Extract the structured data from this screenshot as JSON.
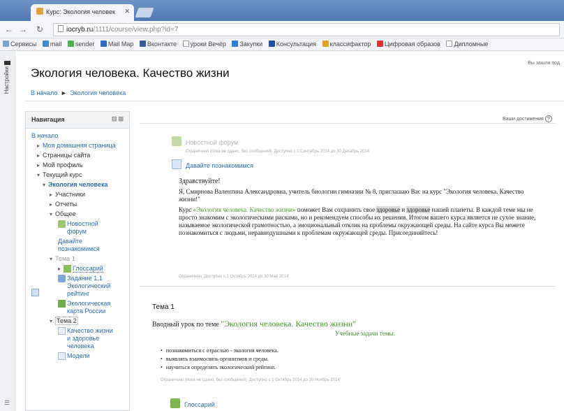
{
  "browser": {
    "tab_title": "Курс: Экология человек",
    "url_host": "iocryb.ru",
    "url_path": "/1111/course/view.php?id=7",
    "bookmarks": [
      "Сервисы",
      "mail",
      "sender",
      "Mail Map",
      "Вконтакте",
      "уроки Вечёр",
      "Закупки",
      "Консультация",
      "классифактор",
      "Цифровая образов",
      "Дипломные"
    ]
  },
  "page": {
    "strip_label": "Настройки",
    "title": "Экология человека. Качество жизни",
    "top_right": "Вы зашли под",
    "breadcrumb": [
      "В начало",
      "Экология человека"
    ],
    "breadcrumb_sep": "►",
    "edit_mode": "Ваши достижения"
  },
  "navigation": {
    "heading": "Навигация",
    "items": [
      {
        "label": "В начало"
      },
      {
        "label": "Моя домашняя страница"
      },
      {
        "label": "Страницы сайта"
      },
      {
        "label": "Мой профиль"
      },
      {
        "label": "Текущий курс"
      },
      {
        "label": "Экология человека"
      },
      {
        "label": "Участники"
      },
      {
        "label": "Отчеты"
      },
      {
        "label": "Общее"
      },
      {
        "label": "Новостной форум"
      },
      {
        "label": "Давайте познакомимся"
      },
      {
        "label": "Тема 1"
      },
      {
        "label": "Глоссарий"
      },
      {
        "label": "Задание 1.1 Экологический рейтинг"
      },
      {
        "label": "Экологическая карта России"
      },
      {
        "label": "Тема 2"
      },
      {
        "label": "Качество жизни и здоровье человека"
      },
      {
        "label": "Модели"
      }
    ]
  },
  "section0": {
    "forum": {
      "name": "Новостной форум",
      "meta": "Ограничено (пока не сдано, без сообщений) 'Доступно с 1 Сентябрь 2014 до 30 Декабрь 2014'"
    },
    "intro_page": {
      "name": "Давайте познакомимся"
    },
    "hello": "Здравствуйте!",
    "p1": "Я, Смирнова Валентина Александровна, учитель биологии гимназии № 8, приглашаю Вас на курс \"Экология человека. Качество жизни!\"",
    "p2_a": "Курс ",
    "p2_course": "«Экология человека. Качество жизни»",
    "p2_b": " поможет Вам сохранить свое ",
    "p2_mark1": "здоровье",
    "p2_c": " и ",
    "p2_mark2": "здоровье",
    "p2_d": " нашей планеты.  В каждой теме мы не просто знакомим с экологическими рисками, но и рекомендуем способы их решения.  Итогом вашего курса является не сухое знание, называемое экологической грамотностью, а эмоциональный отклик на проблемы окружающей среды. На сайте курса Вы можете познакомиться с людьми, неравнодушными к проблемам окружающей среды. Присоединяйтесь!",
    "p2_meta": "Ограничено 'Доступно с 1 Октябрь 2014 до 30 Май 2014'"
  },
  "section1": {
    "title": "Тема 1",
    "intro_prefix": "Вводный урок по теме ",
    "intro_topic": "\"Экология человека. Качество жизни\"",
    "tasks_heading": "Учебные задачи темы:",
    "bullets": [
      "познакомиться с отраслью - экология человека.",
      "выявлять взаимосвязь организмов и среды.",
      "научиться определять экологический рейтинг."
    ],
    "meta": "Ограничено (пока не сдано, без сообщений) 'Доступно с 1 Октябрь 2014 до 30 Ноябрь 2014'",
    "glossary": "Глоссарий"
  },
  "colors": {
    "link": "#2a6db3",
    "accent_green": "#4a9a2f",
    "chrome_blue": "#5b82bd"
  }
}
